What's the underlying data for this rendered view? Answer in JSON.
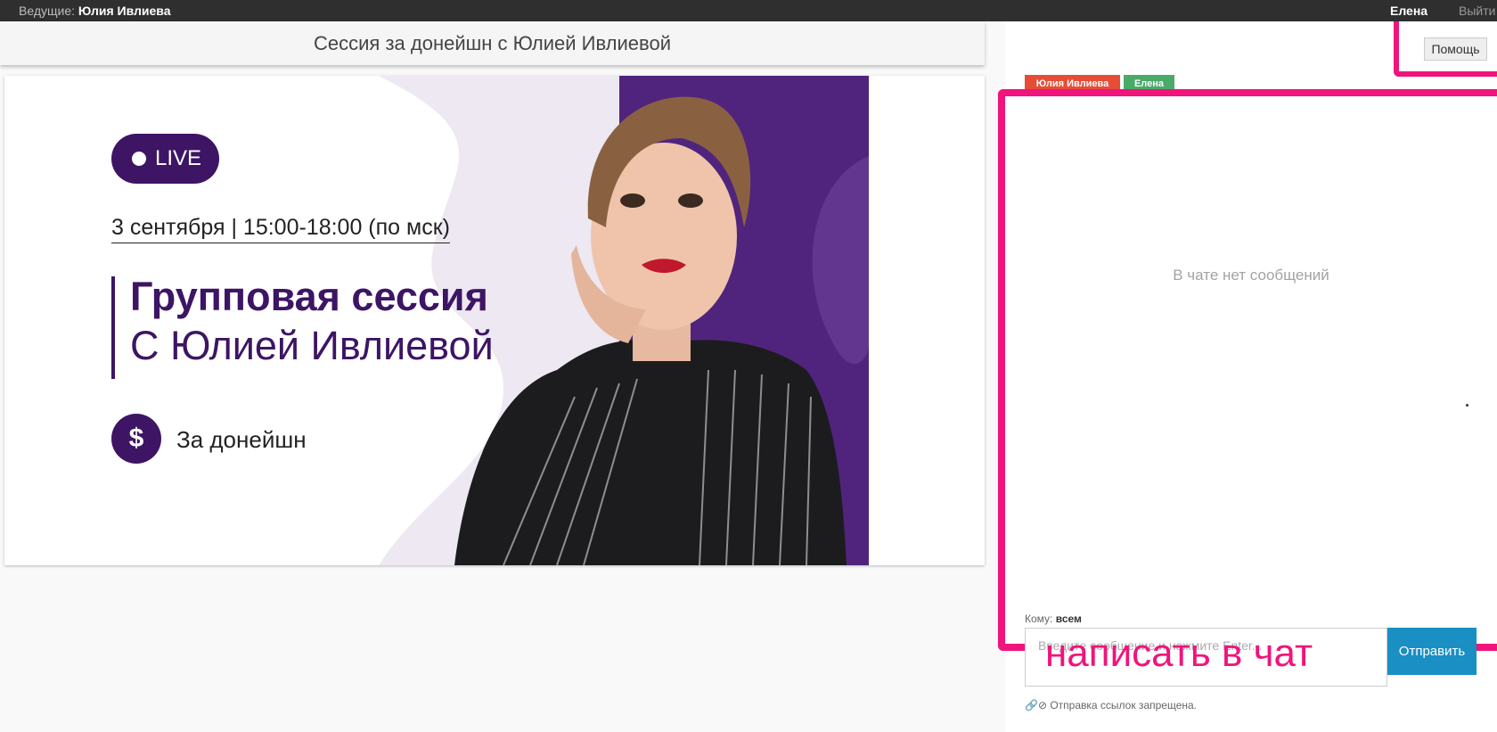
{
  "topbar": {
    "host_label": "Ведущие:",
    "host_name": "Юлия Ивлиева",
    "user_name": "Елена",
    "logout": "Выйти"
  },
  "session": {
    "title": "Сессия за донейшн с Юлией Ивлиевой"
  },
  "banner": {
    "live": "LIVE",
    "date": "3 сентября | 15:00-18:00 (по мск)",
    "headline": "Групповая сессия",
    "subheadline": "С Юлией Ивлиевой",
    "donation": "За донейшн",
    "dollar": "$",
    "colors": {
      "accent": "#3d1564",
      "blob": "#ede8f1",
      "panel": "#50247d"
    }
  },
  "chat": {
    "help_button": "Помощь",
    "participants": [
      "Юлия Ивлиева",
      "Елена"
    ],
    "empty_message": "В чате нет сообщений",
    "to_label": "Кому:",
    "to_value": "всем",
    "input_placeholder": "Введите сообщение и нажмите Enter...",
    "send_button": "Отправить",
    "overlay_annotation": "написать в чат",
    "links_note": "Отправка ссылок запрещена.",
    "highlight_color": "#f0147c"
  }
}
